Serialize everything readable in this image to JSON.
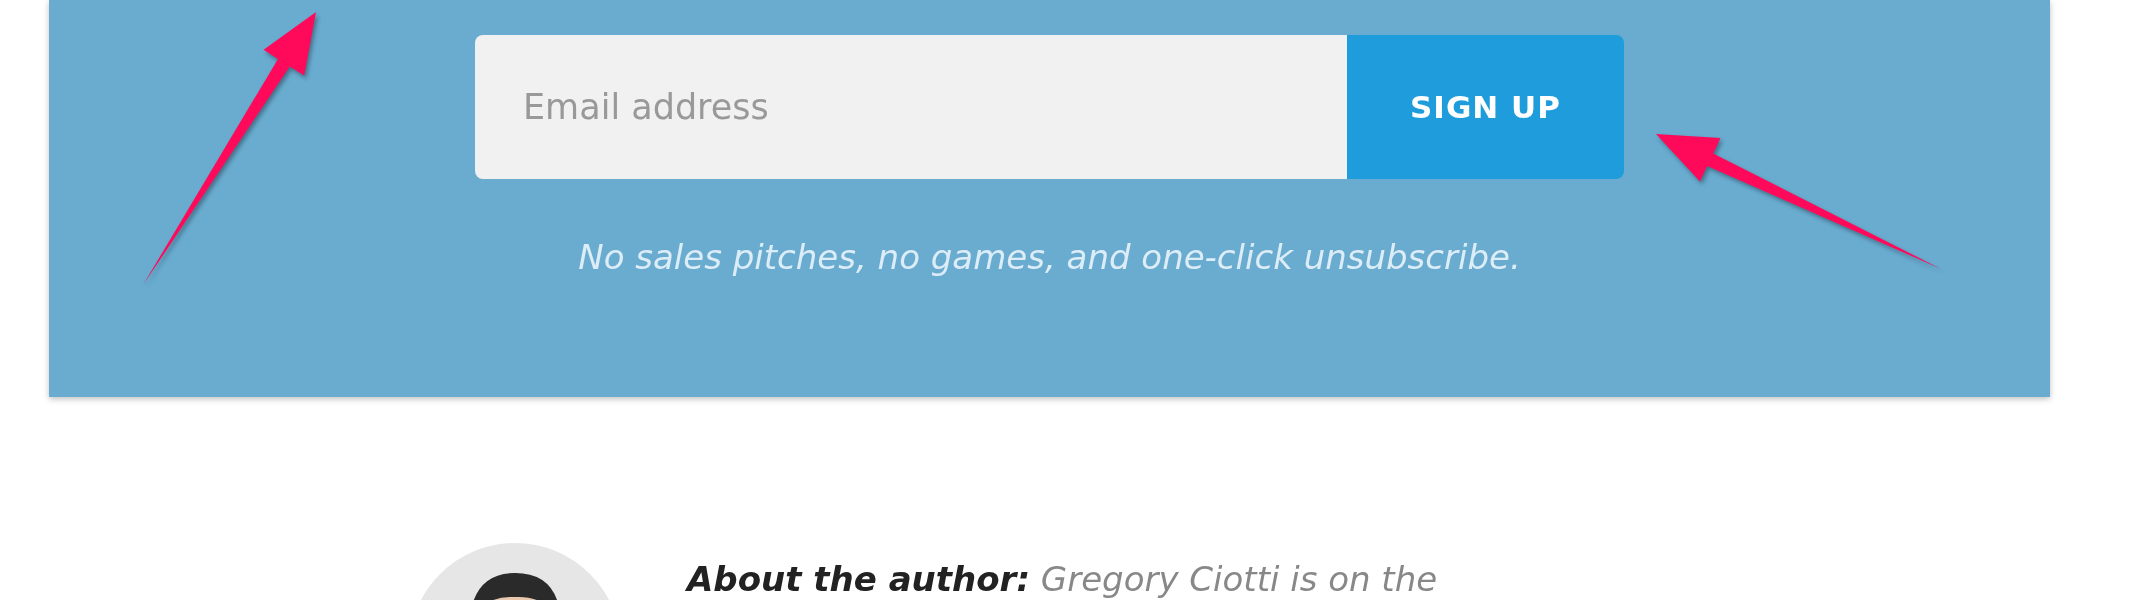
{
  "signup": {
    "email_field": {
      "placeholder": "Email address"
    },
    "button": {
      "label": "SIGN UP"
    },
    "note": "No sales pitches, no games, and one-click unsubscribe."
  },
  "author": {
    "bio": "**About the author:** Gregory Ciotti is on the"
  }
}
